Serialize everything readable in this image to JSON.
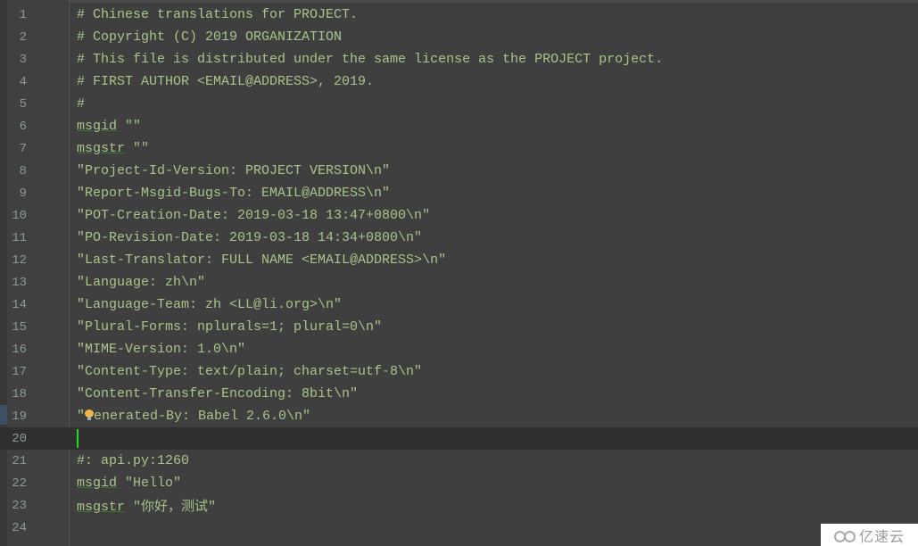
{
  "editor": {
    "current_line": 20,
    "lines": [
      {
        "num": "1",
        "text": "# Chinese translations for PROJECT."
      },
      {
        "num": "2",
        "text": "# Copyright (C) 2019 ORGANIZATION"
      },
      {
        "num": "3",
        "text": "# This file is distributed under the same license as the PROJECT project."
      },
      {
        "num": "4",
        "text": "# FIRST AUTHOR <EMAIL@ADDRESS>, 2019."
      },
      {
        "num": "5",
        "text": "#"
      },
      {
        "num": "6",
        "kw": "msgid",
        "rest": " \"\""
      },
      {
        "num": "7",
        "kw": "msgstr",
        "rest": " \"\""
      },
      {
        "num": "8",
        "text": "\"Project-Id-Version: PROJECT VERSION\\n\""
      },
      {
        "num": "9",
        "text": "\"Report-Msgid-Bugs-To: EMAIL@ADDRESS\\n\""
      },
      {
        "num": "10",
        "text": "\"POT-Creation-Date: 2019-03-18 13:47+0800\\n\""
      },
      {
        "num": "11",
        "text": "\"PO-Revision-Date: 2019-03-18 14:34+0800\\n\""
      },
      {
        "num": "12",
        "text": "\"Last-Translator: FULL NAME <EMAIL@ADDRESS>\\n\""
      },
      {
        "num": "13",
        "text": "\"Language: zh\\n\""
      },
      {
        "num": "14",
        "text": "\"Language-Team: zh <LL@li.org>\\n\""
      },
      {
        "num": "15",
        "text": "\"Plural-Forms: nplurals=1; plural=0\\n\""
      },
      {
        "num": "16",
        "text": "\"MIME-Version: 1.0\\n\""
      },
      {
        "num": "17",
        "text": "\"Content-Type: text/plain; charset=utf-8\\n\""
      },
      {
        "num": "18",
        "text": "\"Content-Transfer-Encoding: 8bit\\n\""
      },
      {
        "num": "19",
        "pre": "\"",
        "rest": "enerated-By: Babel 2.6.0\\n\""
      },
      {
        "num": "20",
        "text": ""
      },
      {
        "num": "21",
        "text": "#: api.py:1260"
      },
      {
        "num": "22",
        "kw": "msgid",
        "rest": " \"Hello\""
      },
      {
        "num": "23",
        "kw": "msgstr",
        "rest": " \"你好，测试\""
      },
      {
        "num": "24",
        "text": ""
      }
    ]
  },
  "icons": {
    "intention_bulb": "lightbulb-icon"
  },
  "watermark": {
    "text": "亿速云",
    "icon": "cloud-logo-icon"
  },
  "colors": {
    "background": "#3f3f3f",
    "current_line": "#2f2f2f",
    "text": "#a8c48a",
    "line_number": "#8a9a9a",
    "caret": "#22dd22"
  }
}
